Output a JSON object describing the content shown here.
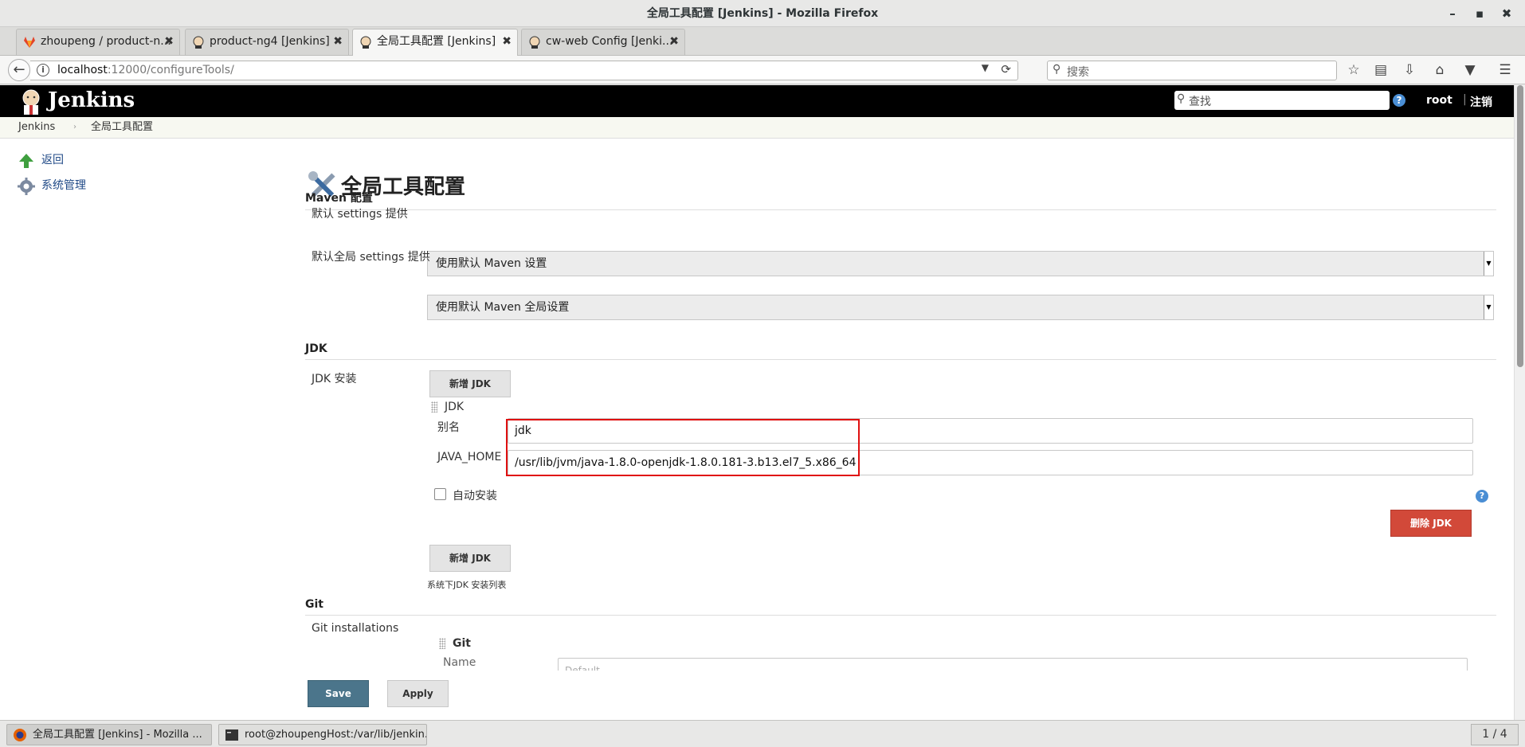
{
  "window": {
    "title": "全局工具配置 [Jenkins] - Mozilla Firefox",
    "min": "–",
    "max": "▪",
    "close": "✖"
  },
  "tabs": [
    {
      "label": "zhoupeng / product-n...",
      "icon": "gitlab-icon"
    },
    {
      "label": "product-ng4 [Jenkins]",
      "icon": "jenkins-icon"
    },
    {
      "label": "全局工具配置 [Jenkins]",
      "icon": "jenkins-icon"
    },
    {
      "label": "cw-web Config [Jenki...",
      "icon": "jenkins-icon"
    }
  ],
  "tab_close": "✖",
  "new_tab": "+",
  "nav": {
    "url_host": "localhost",
    "url_rest": ":12000/configureTools/",
    "search_placeholder": "搜索"
  },
  "jenkins": {
    "title": "Jenkins",
    "search_placeholder": "查找",
    "user": "root",
    "separator": "|",
    "logout": "注销"
  },
  "breadcrumb": {
    "root": "Jenkins",
    "separator": "›",
    "current": "全局工具配置"
  },
  "sidebar": {
    "items": [
      {
        "label": "返回",
        "icon": "up-arrow-icon"
      },
      {
        "label": "系统管理",
        "icon": "gear-icon"
      }
    ]
  },
  "page": {
    "title": "全局工具配置",
    "maven": {
      "heading": "Maven 配置",
      "settings_label": "默认 settings 提供",
      "settings_value": "使用默认 Maven 设置",
      "global_settings_label": "默认全局 settings 提供",
      "global_settings_value": "使用默认 Maven 全局设置"
    },
    "jdk": {
      "heading": "JDK",
      "install_label": "JDK 安装",
      "add_button": "新增 JDK",
      "item_header": "JDK",
      "alias_label": "别名",
      "alias_value": "jdk",
      "java_home_label": "JAVA_HOME",
      "java_home_value": "/usr/lib/jvm/java-1.8.0-openjdk-1.8.0.181-3.b13.el7_5.x86_64",
      "auto_install_label": "自动安装",
      "delete_button": "删除 JDK",
      "add_button_2": "新增 JDK",
      "list_caption": "系统下JDK 安装列表"
    },
    "git": {
      "heading": "Git",
      "installations_label": "Git installations",
      "item_header": "Git",
      "name_label": "Name",
      "name_placeholder": "Default"
    },
    "save_button": "Save",
    "apply_button": "Apply"
  },
  "taskbar": {
    "items": [
      {
        "label": "全局工具配置 [Jenkins] - Mozilla ...",
        "icon": "firefox-icon"
      },
      {
        "label": "root@zhoupengHost:/var/lib/jenkin...",
        "icon": "terminal-icon"
      }
    ],
    "pager": "1 / 4"
  },
  "colors": {
    "jenkins_header": "#000000",
    "save_button": "#4b758b",
    "delete_button": "#d24939",
    "highlight_box": "#e01010",
    "link": "#204a87"
  }
}
